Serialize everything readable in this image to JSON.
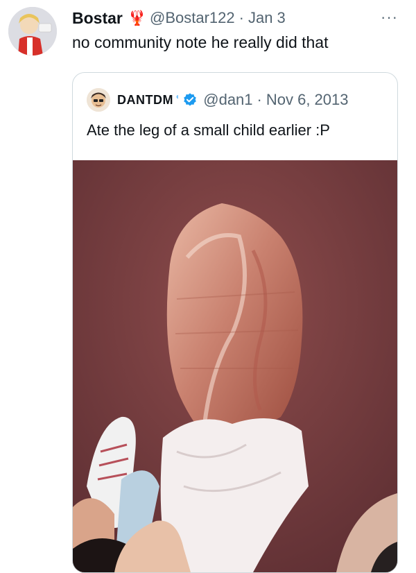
{
  "tweet": {
    "display_name": "Bostar",
    "emoji": "🦞",
    "handle": "@Bostar122",
    "separator": "·",
    "date": "Jan 3",
    "more": "···",
    "text": "no community note he really did that"
  },
  "quote": {
    "display_name": "DANTDM",
    "handle": "@dan1",
    "separator": "·",
    "date": "Nov 6, 2013",
    "text": "Ate the leg of a small child earlier :P",
    "image_description": "photo of a large meat-filled cone held over a red surface"
  },
  "colors": {
    "text_primary": "#0f1419",
    "text_secondary": "#536471",
    "border": "#cfd9de",
    "verified": "#1d9bf0"
  }
}
